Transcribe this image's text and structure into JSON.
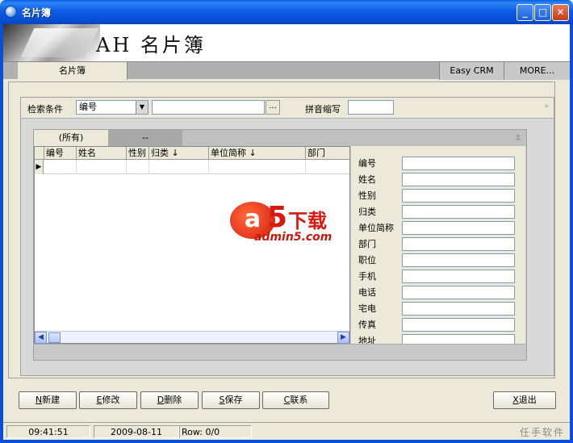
{
  "window": {
    "title": "名片簿",
    "controls": [
      "minimize",
      "maximize",
      "close"
    ]
  },
  "banner": {
    "title": "AH 名片簿"
  },
  "tabbar": {
    "main_tab": "名片簿",
    "links": [
      "Easy CRM",
      "MORE..."
    ]
  },
  "search": {
    "condition_label": "检索条件",
    "field_value": "编号",
    "keyword_value": "",
    "browse_label": "...",
    "pinyin_label": "拼音缩写",
    "pinyin_value": "",
    "collapse_label": "»"
  },
  "grid": {
    "tabs": [
      "(所有)",
      "--"
    ],
    "pin_label": "‡",
    "columns": [
      "编号",
      "姓名",
      "性别",
      "归类 ↓",
      "单位简称 ↓",
      "部门"
    ],
    "rows": [
      [
        "",
        "",
        "",
        "",
        "",
        ""
      ]
    ]
  },
  "detail": {
    "fields": [
      "编号",
      "姓名",
      "性别",
      "归类",
      "单位简称",
      "部门",
      "职位",
      "手机",
      "电话",
      "宅电",
      "传真",
      "地址"
    ]
  },
  "watermark": {
    "letter": "a",
    "digit": "5",
    "text": "下载",
    "url": "admin5.com"
  },
  "buttons": {
    "new": {
      "key": "N",
      "label": "新建"
    },
    "edit": {
      "key": "E",
      "label": "修改"
    },
    "delete": {
      "key": "D",
      "label": "删除"
    },
    "save": {
      "key": "S",
      "label": "保存"
    },
    "contact": {
      "key": "C",
      "label": "联系"
    },
    "exit": {
      "key": "X",
      "label": "退出"
    }
  },
  "status": {
    "time": "09:41:51",
    "date": "2009-08-11",
    "rows": "Row: 0/0",
    "brand": "任手软件"
  },
  "colors": {
    "titlebar": "#0a4fd6",
    "face": "#ece9d8",
    "accent_red": "#d9180e"
  }
}
